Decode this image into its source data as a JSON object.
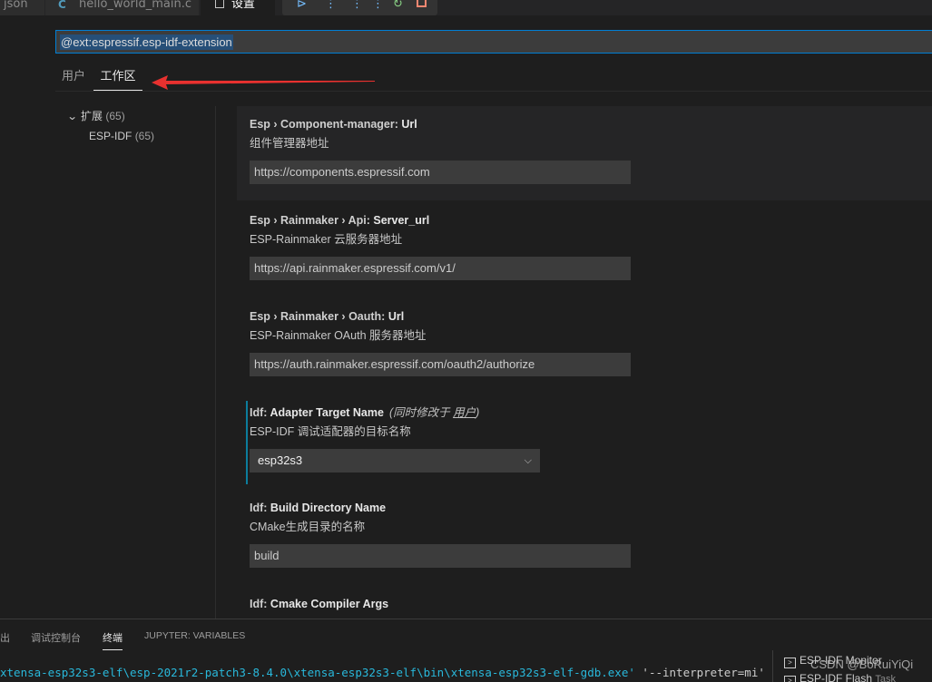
{
  "tabs": {
    "json_tab": "json",
    "main_tab": "hello_world_main.c",
    "main_icon": "C",
    "settings_tab": "设置"
  },
  "search": {
    "value": "@ext:espressif.esp-idf-extension"
  },
  "scope_tabs": {
    "user": "用户",
    "workspace": "工作区"
  },
  "toc": {
    "extensions": {
      "label": "扩展",
      "count": "(65)"
    },
    "esp_idf": {
      "label": "ESP-IDF",
      "count": "(65)"
    }
  },
  "settings": [
    {
      "category": "Esp › Component-manager: ",
      "key": "Url",
      "description": "组件管理器地址",
      "value": "https://components.espressif.com"
    },
    {
      "category": "Esp › Rainmaker › Api: ",
      "key": "Server_url",
      "description": "ESP-Rainmaker 云服务器地址",
      "value": "https://api.rainmaker.espressif.com/v1/"
    },
    {
      "category": "Esp › Rainmaker › Oauth: ",
      "key": "Url",
      "description": "ESP-Rainmaker OAuth 服务器地址",
      "value": "https://auth.rainmaker.espressif.com/oauth2/authorize"
    },
    {
      "category": "Idf: ",
      "key": "Adapter Target Name",
      "extra_prefix": "(同时修改于 ",
      "extra_link": "用户",
      "extra_suffix": ")",
      "description": "ESP-IDF 调试适配器的目标名称",
      "value": "esp32s3"
    },
    {
      "category": "Idf: ",
      "key": "Build Directory Name",
      "description": "CMake生成目录的名称",
      "value": "build"
    },
    {
      "category": "Idf: ",
      "key": "Cmake Compiler Args"
    }
  ],
  "panel": {
    "tabs": {
      "output": "出",
      "debug_console": "调试控制台",
      "terminal": "终端",
      "jupyter": "JUPYTER: VARIABLES"
    },
    "terminal_path": "xtensa-esp32s3-elf\\esp-2021r2-patch3-8.4.0\\xtensa-esp32s3-elf\\bin\\xtensa-esp32s3-elf-gdb.exe'",
    "terminal_arg": " '--interpreter=mi'",
    "terminals": [
      {
        "label": "ESP-IDF Monitor",
        "sub": ""
      },
      {
        "label": "ESP-IDF Flash",
        "sub": "Task"
      }
    ]
  },
  "watermark": "CSDN @BoRuiYiQi",
  "colors": {
    "accent": "#007fd4",
    "annotation_arrow": "#e8312f",
    "modified_indicator": "#0c7d9d"
  }
}
